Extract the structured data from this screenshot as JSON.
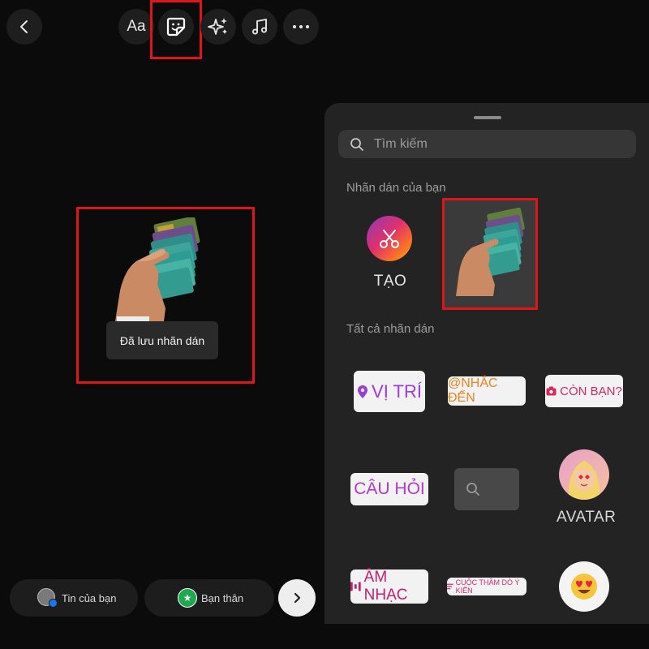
{
  "toolbar": {
    "text_label": "Aa",
    "icons": [
      "back-icon",
      "text-icon",
      "sticker-icon",
      "effects-icon",
      "music-icon",
      "more-icon"
    ]
  },
  "canvas": {
    "toast": "Đã lưu nhãn dán"
  },
  "bottom_bar": {
    "your_story": "Tin của bạn",
    "close_friends": "Bạn thân"
  },
  "sticker_tray": {
    "search_placeholder": "Tìm kiếm",
    "your_stickers_title": "Nhãn dán của bạn",
    "create_label": "TẠO",
    "all_stickers_title": "Tất cả nhãn dán",
    "stickers": {
      "location": "VỊ TRÍ",
      "mention": "@NHẮC ĐẾN",
      "your_turn": "CÒN BẠN?",
      "question": "CÂU HỎI",
      "avatar": "AVATAR",
      "music": "ÂM NHẠC",
      "poll": "CUỘC THĂM DÒ Ý KIẾN"
    }
  },
  "colors": {
    "highlight": "#e0141b",
    "location": "#9b3dd9",
    "mention": "#e8841d",
    "your_turn": "#d6285f",
    "question": "#b23ac9",
    "music": "#c0206f",
    "poll": "#d12b6e"
  }
}
